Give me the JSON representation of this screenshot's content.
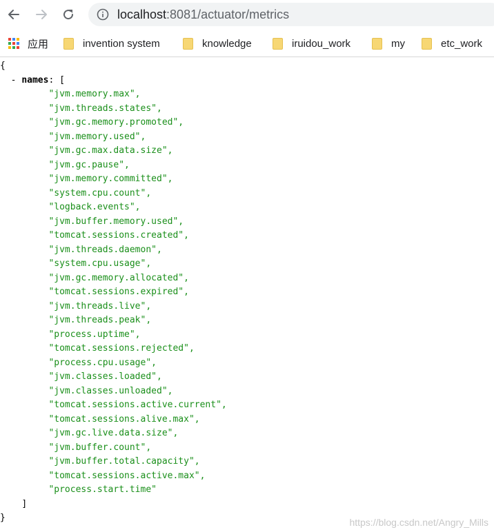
{
  "browser": {
    "url_host": "localhost",
    "url_rest": ":8081/actuator/metrics",
    "bookmarks": [
      {
        "label": "应用",
        "icon": "apps-icon"
      },
      {
        "label": "invention system",
        "icon": "folder-icon"
      },
      {
        "label": "knowledge",
        "icon": "folder-icon"
      },
      {
        "label": "iruidou_work",
        "icon": "folder-icon"
      },
      {
        "label": "my",
        "icon": "folder-icon"
      },
      {
        "label": "etc_work",
        "icon": "folder-icon"
      }
    ]
  },
  "json_view": {
    "open_brace": "{",
    "close_brace": "}",
    "toggle": "-",
    "key": "names",
    "colon_bracket": ": [",
    "close_bracket": "]",
    "names": [
      "jvm.memory.max",
      "jvm.threads.states",
      "jvm.gc.memory.promoted",
      "jvm.memory.used",
      "jvm.gc.max.data.size",
      "jvm.gc.pause",
      "jvm.memory.committed",
      "system.cpu.count",
      "logback.events",
      "jvm.buffer.memory.used",
      "tomcat.sessions.created",
      "jvm.threads.daemon",
      "system.cpu.usage",
      "jvm.gc.memory.allocated",
      "tomcat.sessions.expired",
      "jvm.threads.live",
      "jvm.threads.peak",
      "process.uptime",
      "tomcat.sessions.rejected",
      "process.cpu.usage",
      "jvm.classes.loaded",
      "jvm.classes.unloaded",
      "tomcat.sessions.active.current",
      "tomcat.sessions.alive.max",
      "jvm.gc.live.data.size",
      "jvm.buffer.count",
      "jvm.buffer.total.capacity",
      "tomcat.sessions.active.max",
      "process.start.time"
    ]
  },
  "watermark": "https://blog.csdn.net/Angry_Mills"
}
